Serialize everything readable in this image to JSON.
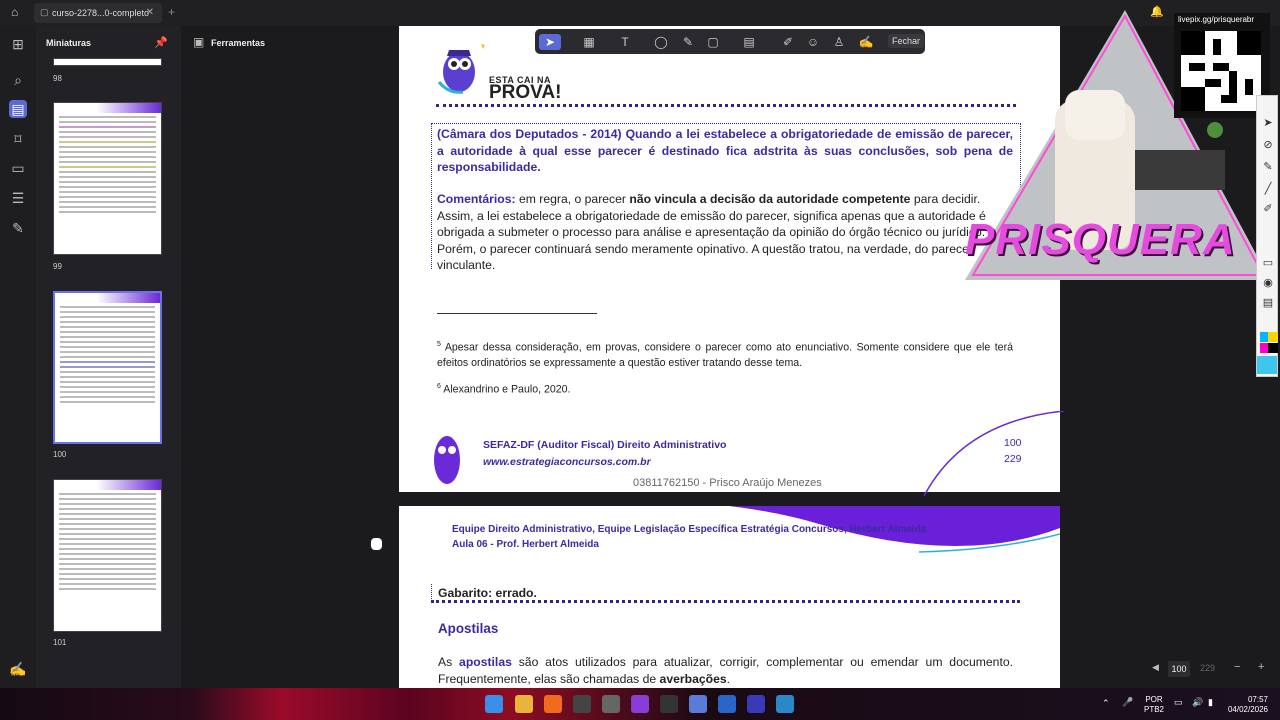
{
  "tab": {
    "title": "curso-2278...0-completo"
  },
  "thumbnails": {
    "title": "Miniaturas",
    "pages": [
      "98",
      "99",
      "100",
      "101"
    ],
    "nav_more": "···"
  },
  "tools": {
    "title": "Ferramentas"
  },
  "annotation_toolbar": {
    "close_label": "Fechar"
  },
  "page1": {
    "logo_small": "ESTA CAI NA",
    "logo_big": "PROVA!",
    "question": "(Câmara dos Deputados - 2014) Quando a lei estabelece a obrigatoriedade de emissão de parecer, a autoridade à qual esse parecer é destinado fica adstrita às suas conclusões, sob pena de responsabilidade.",
    "comment_label": "Comentários:",
    "comment_a": " em regra, o parecer ",
    "comment_b": "não vincula a decisão da autoridade competente",
    "comment_c": " para decidir. Assim, a lei estabelece a obrigatoriedade de emissão do parecer, significa apenas que a autoridade é obrigada a submeter o processo para análise e apresentação da opinião do órgão técnico ou jurídico. Porém, o parecer continuará sendo meramente opinativo. A questão tratou, na verdade, do parecer vinculante.",
    "fn5_num": "5",
    "fn5_text": " Apesar dessa consideração, em provas, considere o parecer como ato enunciativo. Somente considere que ele terá efeitos ordinatórios se expressamente a questão estiver tratando desse tema.",
    "fn6_num": "6",
    "fn6_text": " Alexandrino e Paulo, 2020.",
    "footer_course": "SEFAZ-DF (Auditor Fiscal) Direito Administrativo",
    "footer_url": "www.estrategiaconcursos.com.br",
    "footer_page": "100",
    "footer_total": "229",
    "watermark": "03811762150 - Prisco Araújo Menezes"
  },
  "page2": {
    "header_line1": "Equipe Direito Administrativo, Equipe Legislação Específica Estratégia Concursos, Herbert Almeida",
    "header_line2": "Aula 06 - Prof. Herbert Almeida",
    "answer": "Gabarito: errado.",
    "section_title": "Apostilas",
    "para_a": "As ",
    "para_kw": "apostilas",
    "para_b": " são atos utilizados para atualizar, corrigir, complementar ou emendar um documento. Frequentemente, elas são chamadas de ",
    "para_kw2": "averbações",
    "para_c": "."
  },
  "overlay": {
    "qr_label": "livepix.gg/prisquerabr",
    "brand": "PRISQUERA"
  },
  "zoom": {
    "value": "100",
    "total": "229"
  },
  "taskbar": {
    "lang_line1": "POR",
    "lang_line2": "PTB2",
    "time": "07:57",
    "date": "04/02/2026"
  },
  "colors": {
    "accent": "#5b6bd6",
    "doc_purple": "#3c2aa0",
    "brand_pink": "#e64be0"
  }
}
